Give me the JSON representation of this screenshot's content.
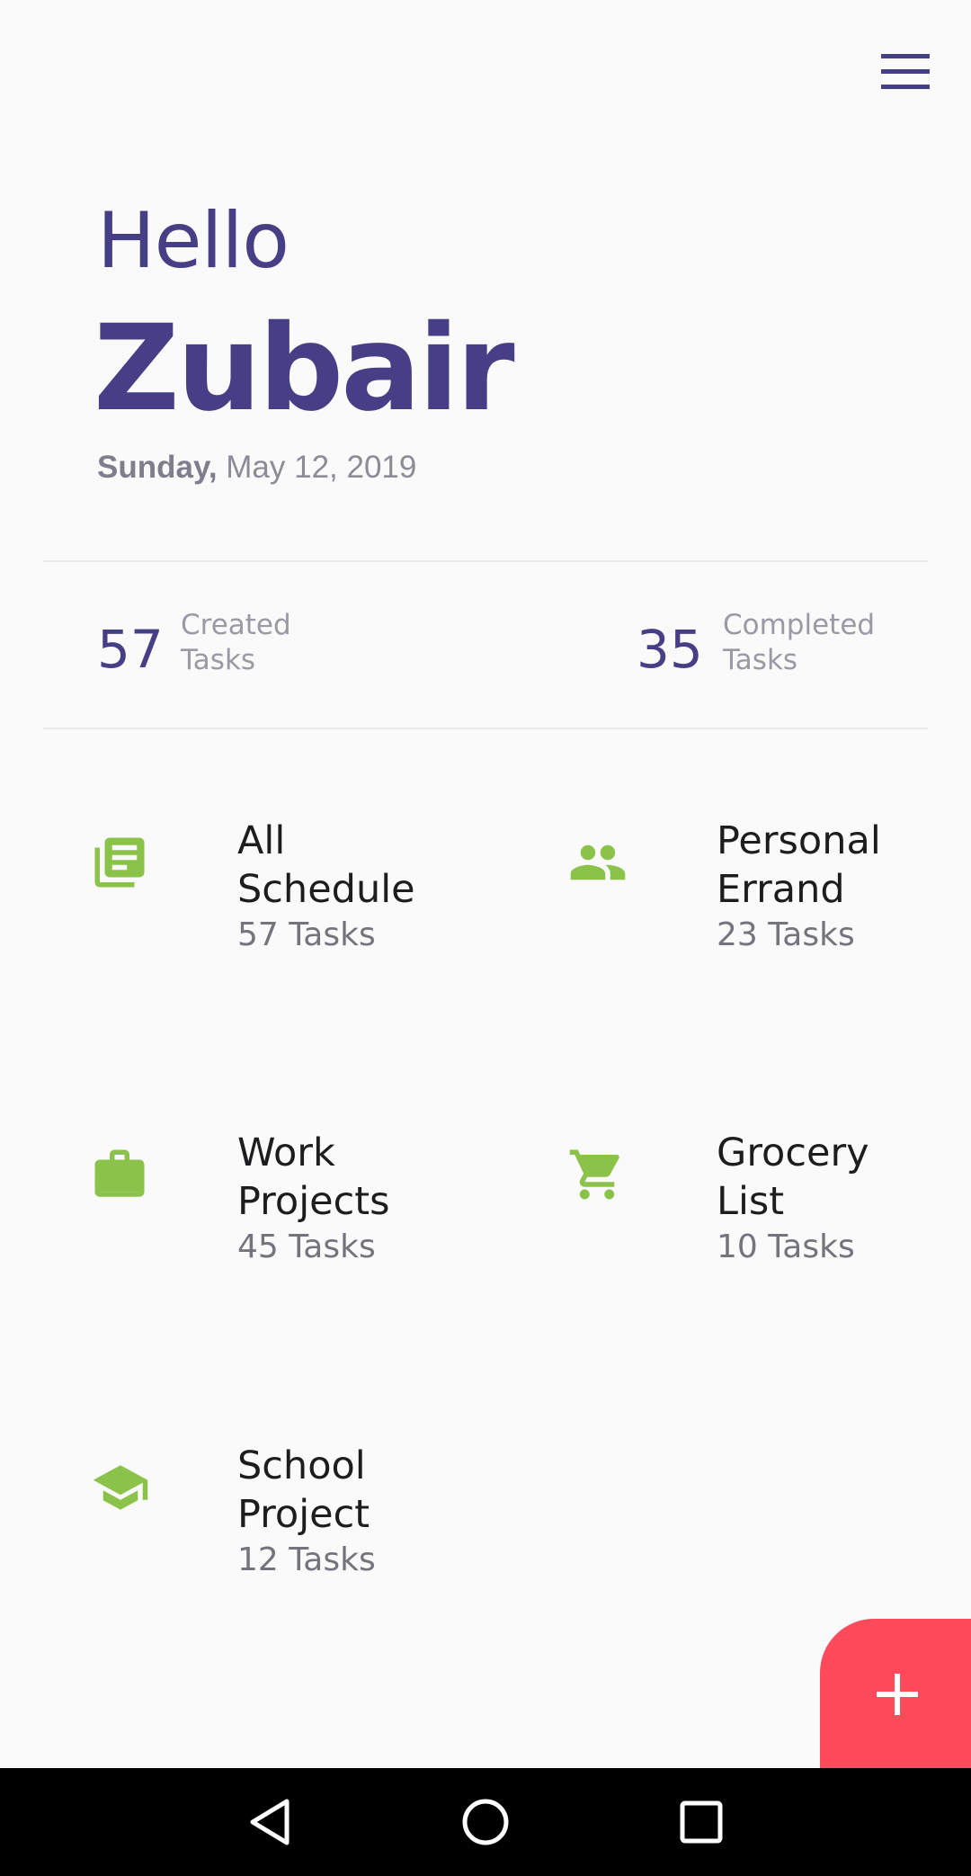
{
  "header": {
    "greeting": "Hello",
    "user_name": "Zubair",
    "date_day": "Sunday,",
    "date_rest": "May 12, 2019"
  },
  "stats": {
    "created": {
      "value": "57",
      "label_line1": "Created",
      "label_line2": "Tasks"
    },
    "completed": {
      "value": "35",
      "label_line1": "Completed",
      "label_line2": "Tasks"
    }
  },
  "categories": [
    {
      "title_line1": "All",
      "title_line2": "Schedule",
      "count": "57 Tasks",
      "icon": "news-icon"
    },
    {
      "title_line1": "Personal",
      "title_line2": "Errand",
      "count": "23 Tasks",
      "icon": "people-icon"
    },
    {
      "title_line1": "Work",
      "title_line2": "Projects",
      "count": "45 Tasks",
      "icon": "briefcase-icon"
    },
    {
      "title_line1": "Grocery",
      "title_line2": "List",
      "count": "10 Tasks",
      "icon": "cart-icon"
    },
    {
      "title_line1": "School",
      "title_line2": "Project",
      "count": "12 Tasks",
      "icon": "graduation-cap-icon"
    }
  ],
  "colors": {
    "primary": "#463f85",
    "accent_icon": "#8bc34a",
    "fab": "#ff4a5c",
    "background": "#fafafa"
  },
  "fab": {
    "icon": "plus-icon"
  },
  "system_nav": {
    "back": "back-icon",
    "home": "home-icon",
    "recents": "recents-icon"
  }
}
